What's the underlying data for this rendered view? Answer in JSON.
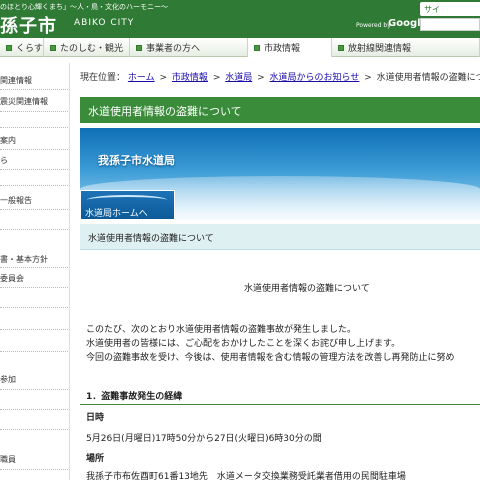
{
  "header": {
    "tagline": "のほとり心輝くまち」～人・鳥・文化のハーモニー～",
    "city_name": "孫子市",
    "city_name_en": "ABIKO CITY",
    "powered_by": "Powered by",
    "google": "Google",
    "site_link": "サイ"
  },
  "gnav": {
    "items": [
      {
        "label": "くらす"
      },
      {
        "label": "たのしむ・観光"
      },
      {
        "label": "事業者の方へ"
      },
      {
        "label": "市政情報"
      },
      {
        "label": "放射線関連情報"
      }
    ]
  },
  "sidebar": {
    "items": [
      {
        "label": "関連情報"
      },
      {
        "label": "震災関連情報"
      },
      {
        "label": "案内"
      },
      {
        "label": "ら"
      },
      {
        "label": "一般報告"
      },
      {
        "label": "書・基本方針"
      },
      {
        "label": "委員会"
      },
      {
        "label": "参加"
      },
      {
        "label": "職員"
      }
    ]
  },
  "breadcrumb": {
    "prefix": "現在位置：",
    "items": [
      "ホーム",
      "市政情報",
      "水道局",
      "水道局からのお知らせ"
    ],
    "current": "水道使用者情報の盗難について",
    "separator": ">"
  },
  "page_title": "水道使用者情報の盗難について",
  "banner": {
    "title": "我孫子市水道局",
    "button_label": "水道局ホームへ"
  },
  "subtitle": "水道使用者情報の盗難について",
  "notice_heading": "水道使用者情報の盗難について",
  "paragraphs": [
    "このたび、次のとおり水道使用者情報の盗難事故が発生しました。",
    "水道使用者の皆様には、ご心配をおかけしたことを深くお詫び申し上げます。",
    "今回の盗難事故を受け、今後は、使用者情報を含む情報の管理方法を改善し再発防止に努め"
  ],
  "section1": {
    "heading": "1．盗難事故発生の経緯",
    "date_label": "日時",
    "date_value": "5月26日(月曜日)17時50分から27日(火曜日)6時30分の間",
    "place_label": "場所",
    "place_value": "我孫子市布佐酉町61番13地先　水道メータ交換業務受託業者借用の民間駐車場"
  }
}
